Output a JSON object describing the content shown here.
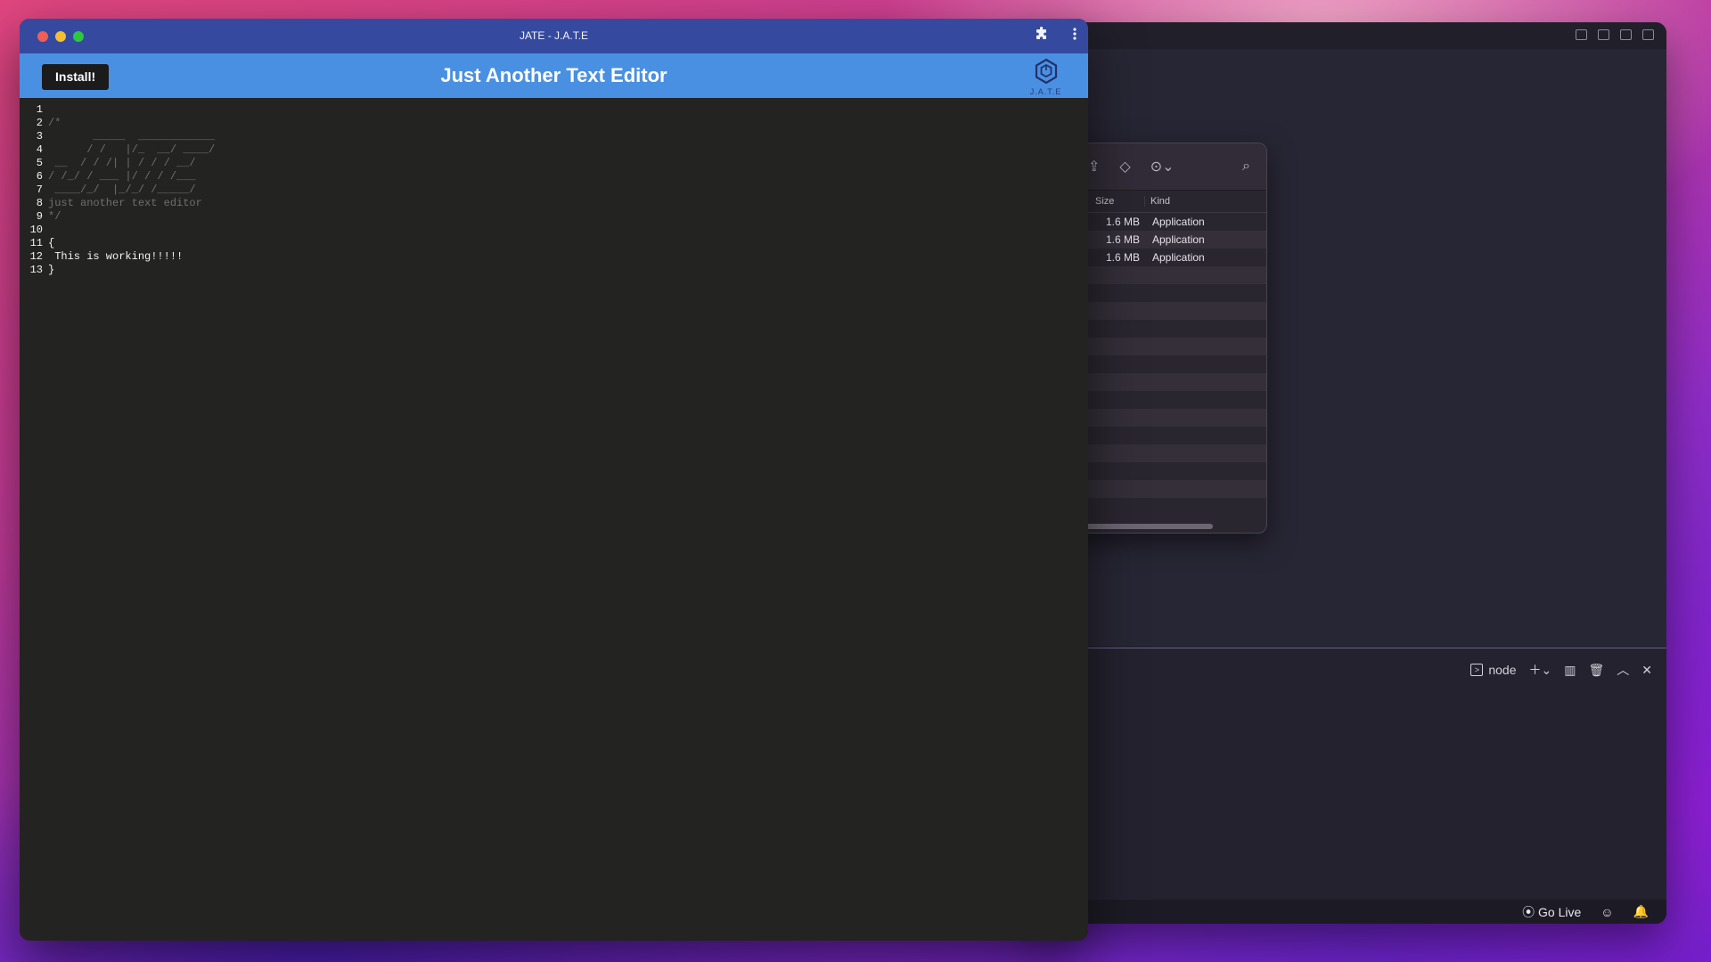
{
  "background_windows": {
    "finder": {
      "columns": [
        "Size",
        "Kind"
      ],
      "rows": [
        {
          "size": "1.6 MB",
          "kind": "Application"
        },
        {
          "size": "1.6 MB",
          "kind": "Application"
        },
        {
          "size": "1.6 MB",
          "kind": "Application"
        }
      ]
    },
    "vscode": {
      "terminal_name": "node",
      "status": {
        "go_live": "Go Live"
      }
    }
  },
  "window": {
    "title": "JATE - J.A.T.E"
  },
  "app": {
    "install_label": "Install!",
    "title": "Just Another Text Editor",
    "logo_text": "J.A.T.E"
  },
  "editor": {
    "lines": [
      {
        "n": "1",
        "text": "",
        "type": "code"
      },
      {
        "n": "2",
        "text": "/*",
        "type": "comment"
      },
      {
        "n": "3",
        "text": "       _____  ____________",
        "type": "comment"
      },
      {
        "n": "4",
        "text": "      / /   |/_  __/ ____/",
        "type": "comment"
      },
      {
        "n": "5",
        "text": " __  / / /| | / / / __/",
        "type": "comment"
      },
      {
        "n": "6",
        "text": "/ /_/ / ___ |/ / / /___",
        "type": "comment"
      },
      {
        "n": "7",
        "text": " ____/_/  |_/_/ /_____/",
        "type": "comment"
      },
      {
        "n": "8",
        "text": "just another text editor",
        "type": "comment"
      },
      {
        "n": "9",
        "text": "*/",
        "type": "comment"
      },
      {
        "n": "10",
        "text": "",
        "type": "code"
      },
      {
        "n": "11",
        "text": "{",
        "type": "code"
      },
      {
        "n": "12",
        "text": " This is working!!!!!",
        "type": "code"
      },
      {
        "n": "13",
        "text": "}",
        "type": "code"
      }
    ]
  }
}
